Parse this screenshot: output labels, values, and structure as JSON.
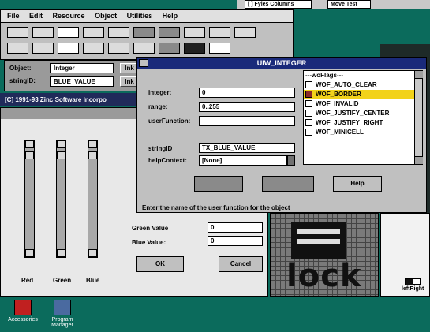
{
  "top_buttons": [
    "[ ] Fyles Columns",
    "Move Test"
  ],
  "menu": [
    "File",
    "Edit",
    "Resource",
    "Object",
    "Utilities",
    "Help"
  ],
  "object_panel": {
    "object_label": "Object:",
    "object_value": "Integer",
    "string_label": "stringID:",
    "string_value": "BLUE_VALUE",
    "side_labels": [
      "lnk",
      "lnk"
    ]
  },
  "copyright": "[C] 1991-93 Zinc Software Incorpo",
  "dialog": {
    "title": "UIW_INTEGER",
    "integer_label": "integer:",
    "integer_value": "0",
    "range_label": "range:",
    "range_value": "0..255",
    "userfunction_label": "userFunction:",
    "userfunction_value": "",
    "stringid_label": "stringID",
    "stringid_value": "TX_BLUE_VALUE",
    "helpcontext_label": "helpContext:",
    "helpcontext_value": "[None]",
    "flags_header": "---woFlags---",
    "flags": [
      {
        "label": "WOF_AUTO_CLEAR",
        "checked": false,
        "selected": false
      },
      {
        "label": "WOF_BORDER",
        "checked": true,
        "selected": true
      },
      {
        "label": "WOF_INVALID",
        "checked": false,
        "selected": false
      },
      {
        "label": "WOF_JUSTIFY_CENTER",
        "checked": false,
        "selected": false
      },
      {
        "label": "WOF_JUSTIFY_RIGHT",
        "checked": false,
        "selected": false
      },
      {
        "label": "WOF_MINICELL",
        "checked": false,
        "selected": false
      }
    ],
    "help_button": "Help",
    "status": "Enter the name of the user function for the object"
  },
  "color_window": {
    "green_label": "Green Value",
    "green_value": "0",
    "blue_label": "Blue Value:",
    "blue_value": "0",
    "ok_button": "OK",
    "cancel_button": "Cancel",
    "slider_labels": [
      "Red",
      "Green",
      "Blue"
    ]
  },
  "bitmap_text": "lock",
  "leftright_label": "leftRight",
  "desktop_icons": [
    "Accessories",
    "Program Manager"
  ],
  "colors": {
    "desktop": "#0b6b5c",
    "active_title": "#1a2a7a",
    "selected_flag": "#f2d21a"
  }
}
